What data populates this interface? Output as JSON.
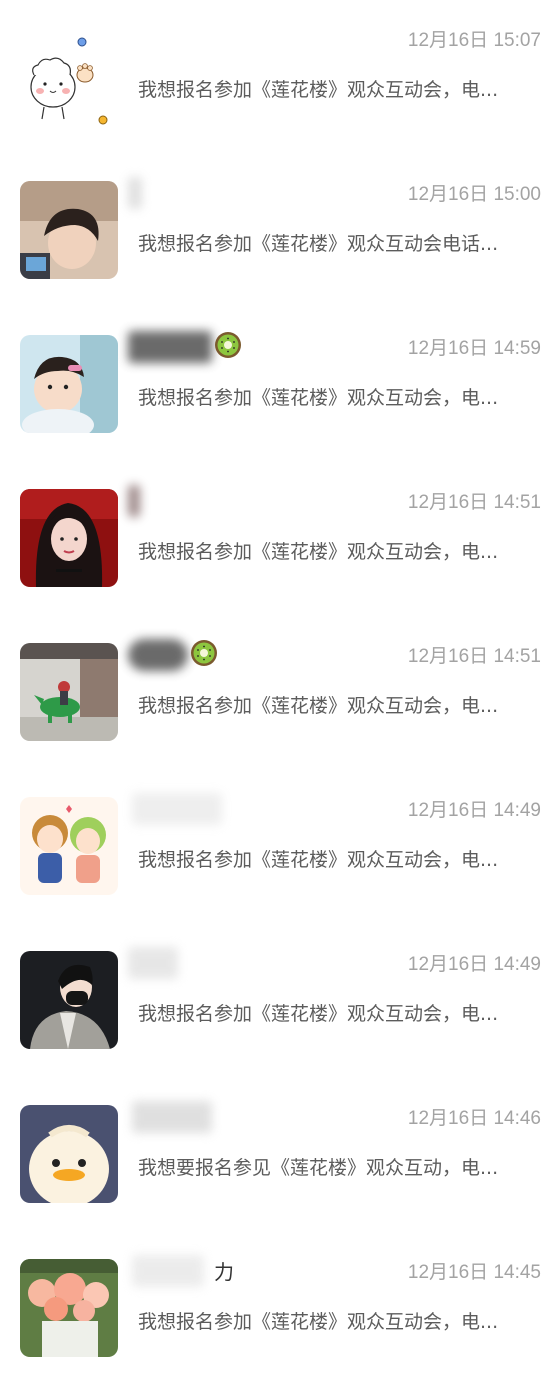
{
  "messages": [
    {
      "name": "",
      "time": "12月16日 15:07",
      "preview": "我想报名参加《莲花楼》观众互动会，电..."
    },
    {
      "name": "",
      "time": "12月16日 15:00",
      "preview": "我想报名参加《莲花楼》观众互动会电话..."
    },
    {
      "name": "",
      "time": "12月16日 14:59",
      "preview": "我想报名参加《莲花楼》观众互动会，电..."
    },
    {
      "name": "",
      "time": "12月16日 14:51",
      "preview": "我想报名参加《莲花楼》观众互动会，电..."
    },
    {
      "name": "",
      "time": "12月16日 14:51",
      "preview": "我想报名参加《莲花楼》观众互动会，电..."
    },
    {
      "name": "",
      "time": "12月16日 14:49",
      "preview": "我想报名参加《莲花楼》观众互动会，电..."
    },
    {
      "name": "",
      "time": "12月16日 14:49",
      "preview": "我想报名参加《莲花楼》观众互动会，电..."
    },
    {
      "name": "",
      "time": "12月16日 14:46",
      "preview": "我想要报名参见《莲花楼》观众互动，电..."
    },
    {
      "name": "力",
      "time": "12月16日 14:45",
      "preview": "我想报名参加《莲花楼》观众互动会，电..."
    }
  ],
  "icons": {
    "kiwi": "kiwi-emoji-icon"
  }
}
